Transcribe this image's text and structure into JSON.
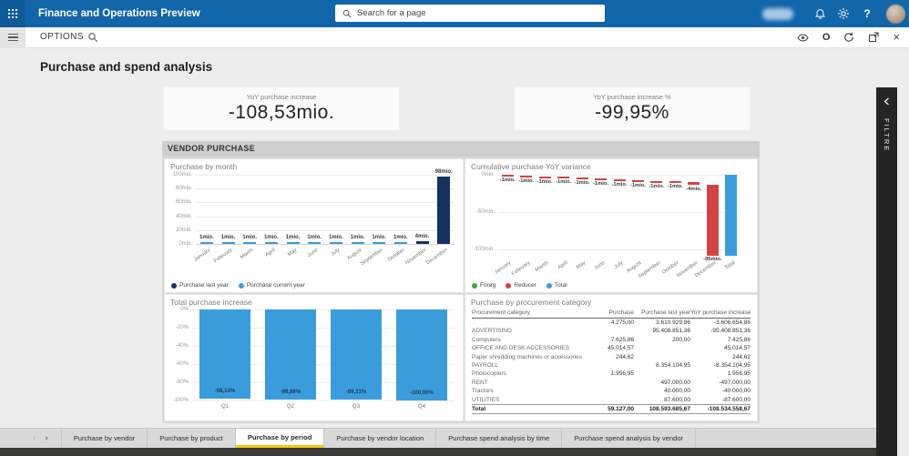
{
  "topbar": {
    "app_title": "Finance and Operations Preview",
    "search_placeholder": "Search for a page",
    "help_glyph": "?"
  },
  "actionbar": {
    "options_label": "OPTIONS",
    "close_glyph": "×",
    "office_glyph": "O"
  },
  "page": {
    "title": "Purchase and spend analysis"
  },
  "kpis": [
    {
      "label": "YoY purchase increase",
      "value": "-108,53mio."
    },
    {
      "label": "YoY purchase increase %",
      "value": "-99,95%"
    }
  ],
  "vendor_section": {
    "title": "VENDOR PURCHASE"
  },
  "filter_panel": {
    "label": "FILTRE"
  },
  "page_tabs": {
    "items": [
      "Purchase by vendor",
      "Purchase by product",
      "Purchase by period",
      "Purchase by vendor location",
      "Purchase spend analysis by time",
      "Purchase spend analysis by vendor"
    ],
    "active_index": 2,
    "scroll_left_glyph": "‹",
    "scroll_right_glyph": "›"
  },
  "colors": {
    "topbar_blue": "#1165a9",
    "navy": "#17325E",
    "light_blue": "#3B9CDB",
    "red": "#D24444",
    "green": "#44A544",
    "accent_yellow": "#F2C811"
  },
  "chart_data": [
    {
      "type": "bar",
      "title": "Purchase by month",
      "unit": "mio.",
      "categories": [
        "January",
        "February",
        "March",
        "April",
        "May",
        "June",
        "July",
        "August",
        "September",
        "October",
        "November",
        "December"
      ],
      "series": [
        {
          "name": "Purchase last year",
          "color": "#17325E",
          "values": [
            0,
            0,
            0,
            0,
            0,
            0,
            0,
            0,
            0,
            0,
            4,
            98
          ]
        },
        {
          "name": "Purchase current year",
          "color": "#3B9CDB",
          "values": [
            1,
            1,
            1,
            1,
            1,
            1,
            1,
            1,
            1,
            1,
            0,
            0
          ]
        }
      ],
      "bar_labels": [
        "1mio.",
        "1mio.",
        "1mio.",
        "1mio.",
        "1mio.",
        "1mio.",
        "1mio.",
        "1mio.",
        "1mio.",
        "1mio.",
        "4mio.",
        "98mio."
      ],
      "yticks": [
        "100mio.",
        "80mio.",
        "60mio.",
        "40mio.",
        "20mio.",
        "0mio."
      ],
      "ylim": [
        0,
        100
      ],
      "grid": true,
      "legend_position": "bottom"
    },
    {
      "type": "waterfall",
      "title": "Cumulative purchase YoY variance",
      "unit": "mio.",
      "categories": [
        "January",
        "February",
        "March",
        "April",
        "May",
        "June",
        "July",
        "August",
        "September",
        "October",
        "November",
        "December",
        "Total"
      ],
      "values": [
        -1,
        -1,
        -1,
        -1,
        -1,
        -1,
        -1,
        -1,
        -1,
        -1,
        -4,
        -95,
        -109
      ],
      "bar_labels": [
        "-1mio.",
        "-1mio.",
        "-1mio.",
        "-1mio.",
        "-1mio.",
        "-1mio.",
        "-1mio.",
        "-1mio.",
        "-1mio.",
        "-1mio.",
        "-4mio.",
        "-95mio.",
        ""
      ],
      "yticks": [
        "0mio.",
        "-50mio.",
        "-100mio."
      ],
      "ylim": [
        0,
        -100
      ],
      "grid": true,
      "color_increase": "#44A544",
      "color_decrease": "#D24444",
      "color_total": "#3B9CDB",
      "legend": [
        {
          "label": "Forøg",
          "color": "#44A544"
        },
        {
          "label": "Reducer",
          "color": "#D24444"
        },
        {
          "label": "Total",
          "color": "#3B9CDB"
        }
      ],
      "legend_position": "bottom"
    },
    {
      "type": "bar",
      "title": "Total purchase increase",
      "categories": [
        "Q1",
        "Q2",
        "Q3",
        "Q4"
      ],
      "values": [
        -98.14,
        -98.86,
        -99.31,
        -100.0
      ],
      "bar_labels": [
        "-98,14%",
        "-98,86%",
        "-99,31%",
        "-100,00%"
      ],
      "bar_color": "#3B9CDB",
      "yticks": [
        "0%",
        "-20%",
        "-40%",
        "-60%",
        "-80%",
        "-100%"
      ],
      "ylim": [
        0,
        -100
      ],
      "grid": true
    },
    {
      "type": "table",
      "title": "Purchase by procurement category",
      "columns": [
        "Procurement category",
        "Purchase",
        "Purchase last year",
        "YoY purchase increase"
      ],
      "rows": [
        [
          "",
          "4.275,00",
          "3.610.929,86",
          "-3.606.654,86"
        ],
        [
          "ADVERTISING",
          "",
          "95.408.851,36",
          "-95.408.851,36"
        ],
        [
          "Computers",
          "7.625,86",
          "200,00",
          "7.425,86"
        ],
        [
          "OFFICE AND DESK ACCESSORIES",
          "45.014,57",
          "",
          "45.014,57"
        ],
        [
          "Paper shredding machines or accessories",
          "244,62",
          "",
          "244,62"
        ],
        [
          "PAYROLL",
          "",
          "8.354.104,95",
          "-8.354.104,95"
        ],
        [
          "Photocopiers",
          "1.956,95",
          "",
          "1.956,95"
        ],
        [
          "RENT",
          "",
          "497.000,00",
          "-497.000,00"
        ],
        [
          "Tractors",
          "",
          "40.000,00",
          "-40.000,00"
        ],
        [
          "UTILITIES",
          "",
          "87.600,00",
          "-87.600,00"
        ]
      ],
      "total_row": [
        "Total",
        "59.127,00",
        "108.593.685,67",
        "-108.534.558,67"
      ]
    }
  ]
}
